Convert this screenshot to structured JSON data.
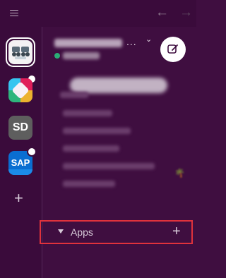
{
  "topbar": {
    "menu_icon": "hamburger-icon",
    "back_icon": "←",
    "forward_icon": "→"
  },
  "rail": {
    "workspaces": [
      {
        "icon": "workspace-logo-icon",
        "active": true
      },
      {
        "icon": "slack-logo-icon",
        "unread": true
      },
      {
        "label": "SD"
      },
      {
        "label": "SAP",
        "unread": true
      }
    ],
    "add_symbol": "+"
  },
  "header": {
    "more_symbol": "...",
    "chevron_symbol": "⌄",
    "compose_icon": "compose-icon"
  },
  "sidebar": {
    "decoration_emoji": "🌴",
    "apps_section": {
      "caret_icon": "caret-down-icon",
      "label": "Apps",
      "add_symbol": "+"
    }
  },
  "colors": {
    "sidebar_bg": "#3f0e40",
    "rail_bg": "#3a0b3b",
    "presence": "#2bac76",
    "highlight": "#e0323c"
  }
}
